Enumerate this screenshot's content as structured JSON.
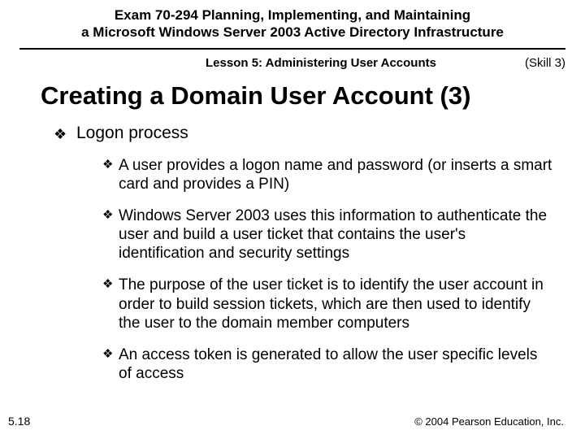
{
  "header": {
    "title_line1": "Exam 70-294 Planning, Implementing, and Maintaining",
    "title_line2": "a Microsoft Windows Server 2003 Active Directory Infrastructure"
  },
  "subheader": {
    "lesson": "Lesson 5: Administering User Accounts",
    "skill": "(Skill 3)"
  },
  "main_title": "Creating a Domain User Account (3)",
  "marker": "❖",
  "bullet1": "Logon process",
  "sub_bullets": [
    "A user provides a logon name and password (or inserts a smart card and provides a PIN)",
    "Windows Server 2003 uses this information to authenticate the user and build a user ticket that contains the user's identification and security settings",
    "The purpose of the user ticket is to identify the user account in order to build session tickets, which are then used to identify the user to the domain member computers",
    "An access token is generated to allow the user specific levels of access"
  ],
  "slide_number": "5.18",
  "copyright": "© 2004 Pearson Education, Inc."
}
